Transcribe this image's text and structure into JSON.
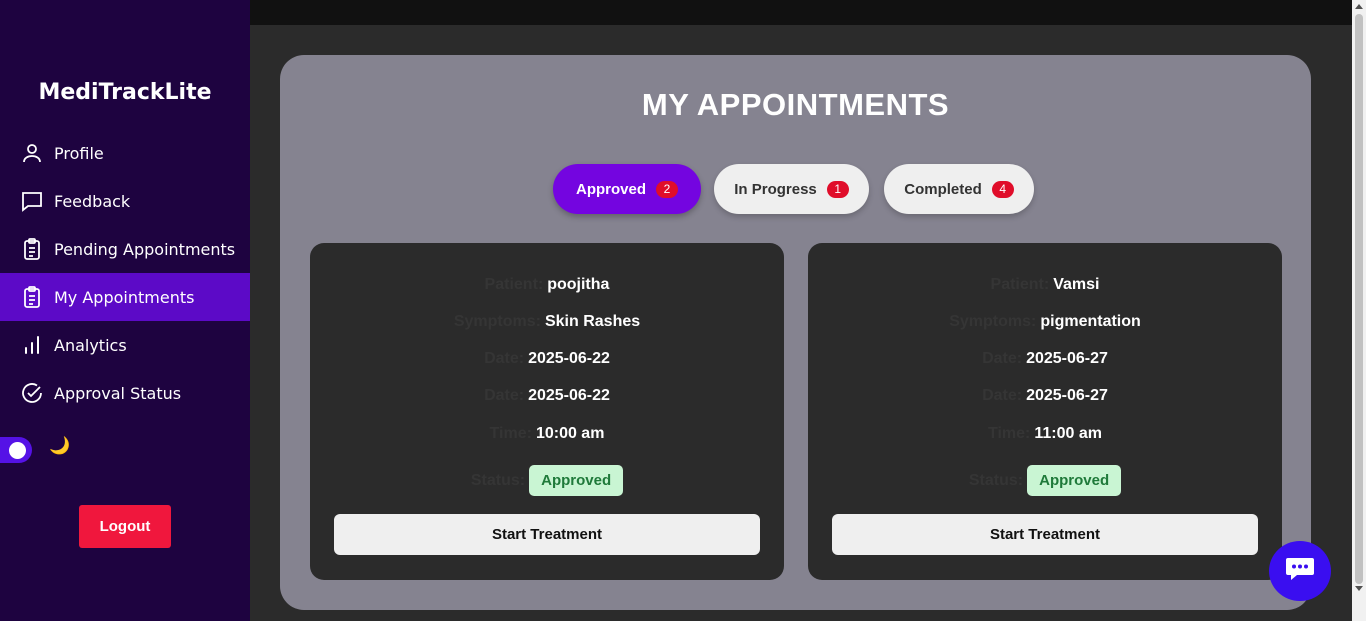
{
  "app": {
    "title": "MediTrackLite"
  },
  "sidebar": {
    "items": [
      {
        "label": "Profile",
        "icon": "user-icon",
        "active": false
      },
      {
        "label": "Feedback",
        "icon": "chat-square-icon",
        "active": false
      },
      {
        "label": "Pending Appointments",
        "icon": "clipboard-icon",
        "active": false
      },
      {
        "label": "My Appointments",
        "icon": "clipboard-icon",
        "active": true
      },
      {
        "label": "Analytics",
        "icon": "bar-chart-icon",
        "active": false
      },
      {
        "label": "Approval Status",
        "icon": "check-circle-icon",
        "active": false
      }
    ],
    "theme_toggle": {
      "icon": "moon-icon",
      "glyph": "🌙"
    },
    "logout_label": "Logout"
  },
  "main": {
    "title": "MY APPOINTMENTS",
    "tabs": [
      {
        "label": "Approved",
        "count": "2",
        "active": true
      },
      {
        "label": "In Progress",
        "count": "1",
        "active": false
      },
      {
        "label": "Completed",
        "count": "4",
        "active": false
      }
    ],
    "cards": [
      {
        "fields": [
          {
            "label": "Patient:",
            "value": "poojitha"
          },
          {
            "label": "Symptoms:",
            "value": "Skin Rashes"
          },
          {
            "label": "Date:",
            "value": "2025-06-22"
          },
          {
            "label": "Date:",
            "value": "2025-06-22"
          },
          {
            "label": "Time:",
            "value": "10:00 am"
          }
        ],
        "status_label": "Status:",
        "status": "Approved",
        "action": "Start Treatment"
      },
      {
        "fields": [
          {
            "label": "Patient:",
            "value": "Vamsi"
          },
          {
            "label": "Symptoms:",
            "value": "pigmentation"
          },
          {
            "label": "Date:",
            "value": "2025-06-27"
          },
          {
            "label": "Date:",
            "value": "2025-06-27"
          },
          {
            "label": "Time:",
            "value": "11:00 am"
          }
        ],
        "status_label": "Status:",
        "status": "Approved",
        "action": "Start Treatment"
      }
    ]
  },
  "colors": {
    "sidebar_bg": "#1e0340",
    "active_nav": "#5c0ac7",
    "accent": "#7405e0",
    "badge": "#e00d2a",
    "status_bg": "#c9f5d3",
    "logout": "#f0173d"
  },
  "chat_button": {
    "icon": "chat-bubble-icon"
  }
}
